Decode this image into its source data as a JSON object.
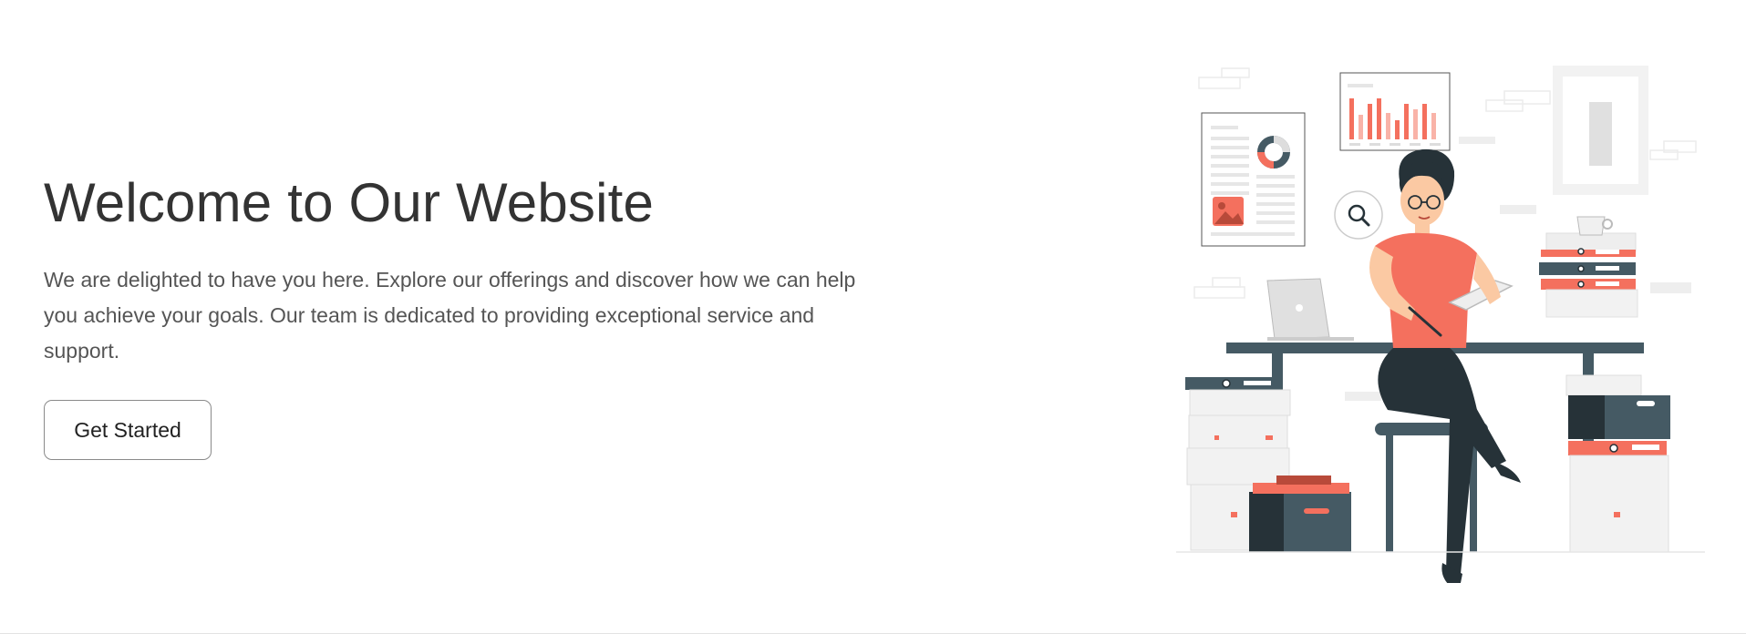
{
  "hero": {
    "title": "Welcome to Our Website",
    "description": "We are delighted to have you here. Explore our offerings and discover how we can help you achieve your goals. Our team is dedicated to providing exceptional service and support.",
    "cta_label": "Get Started"
  },
  "illustration": {
    "subject": "person-working-at-desk",
    "icons": [
      "bar-chart-frame",
      "document-with-donut-chart",
      "search-icon",
      "laptop",
      "tablet",
      "folders",
      "coffee-mug",
      "picture-frame",
      "file-box"
    ]
  },
  "colors": {
    "background": "#ffffff",
    "title": "#333333",
    "text": "#555555",
    "button_border": "#8a8a8a",
    "accent_coral": "#f4705e",
    "dark_slate": "#455a64",
    "dark_navy": "#263238"
  }
}
